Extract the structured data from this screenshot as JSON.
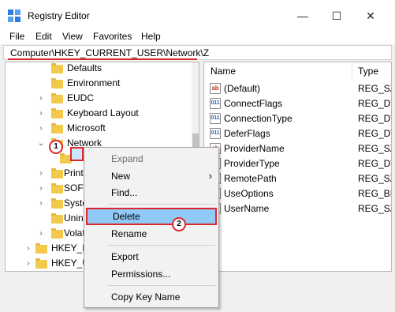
{
  "window": {
    "title": "Registry Editor",
    "minimize": "—",
    "maximize": "☐",
    "close": "✕"
  },
  "menubar": [
    "File",
    "Edit",
    "View",
    "Favorites",
    "Help"
  ],
  "address": "Computer\\HKEY_CURRENT_USER\\Network\\Z",
  "tree": [
    {
      "label": "Defaults"
    },
    {
      "label": "Environment"
    },
    {
      "label": "EUDC",
      "arrow": "›"
    },
    {
      "label": "Keyboard Layout",
      "arrow": "›"
    },
    {
      "label": "Microsoft",
      "arrow": "›"
    },
    {
      "label": "Network",
      "arrow": "⌄"
    },
    {
      "label": "Z"
    },
    {
      "label": "Print",
      "arrow": "›"
    },
    {
      "label": "SOFT",
      "arrow": "›"
    },
    {
      "label": "Syste",
      "arrow": "›"
    },
    {
      "label": "Unin"
    },
    {
      "label": "Volat",
      "arrow": "›"
    },
    {
      "label": "HKEY_L",
      "arrow": "›"
    },
    {
      "label": "HKEY_U",
      "arrow": "›"
    },
    {
      "label": "HKEY_C",
      "arrow": "›"
    }
  ],
  "list": {
    "headers": {
      "name": "Name",
      "type": "Type"
    },
    "rows": [
      {
        "name": "(Default)",
        "type": "REG_SZ",
        "icon": "ab"
      },
      {
        "name": "ConnectFlags",
        "type": "REG_DW",
        "icon": "bin"
      },
      {
        "name": "ConnectionType",
        "type": "REG_DW",
        "icon": "bin"
      },
      {
        "name": "DeferFlags",
        "type": "REG_DW",
        "icon": "bin"
      },
      {
        "name": "ProviderName",
        "type": "REG_SZ",
        "icon": "ab"
      },
      {
        "name": "ProviderType",
        "type": "REG_DW",
        "icon": "bin"
      },
      {
        "name": "RemotePath",
        "type": "REG_SZ",
        "icon": "ab"
      },
      {
        "name": "UseOptions",
        "type": "REG_BIN",
        "icon": "bin"
      },
      {
        "name": "UserName",
        "type": "REG_SZ",
        "icon": "ab"
      }
    ],
    "icon_glyphs": {
      "ab": "ab",
      "bin": "011"
    }
  },
  "context_menu": {
    "expand": "Expand",
    "new": "New",
    "new_arrow": "›",
    "find": "Find...",
    "delete": "Delete",
    "rename": "Rename",
    "export": "Export",
    "permissions": "Permissions...",
    "copy_key_name": "Copy Key Name"
  },
  "annotations": {
    "step1": "1",
    "step2": "2"
  },
  "colors": {
    "highlight": "#91c9f7",
    "annotation_red": "#e0262d",
    "folder": "#f3c94c"
  }
}
